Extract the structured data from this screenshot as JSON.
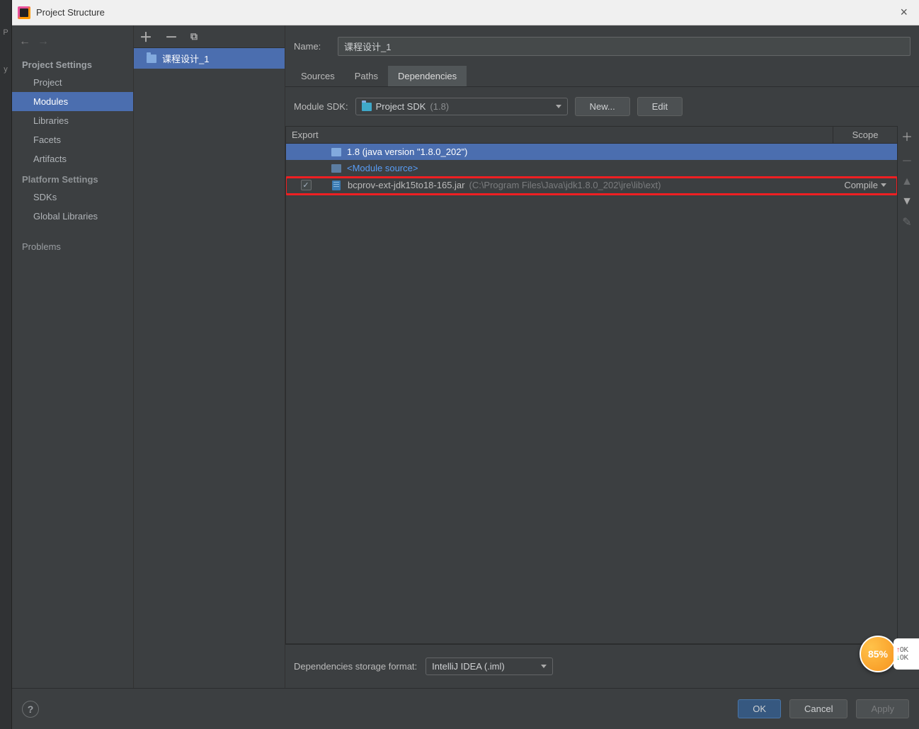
{
  "window": {
    "title": "Project Structure"
  },
  "sidebar": {
    "sections": {
      "project": "Project Settings",
      "platform": "Platform Settings"
    },
    "items": {
      "project": "Project",
      "modules": "Modules",
      "libraries": "Libraries",
      "facets": "Facets",
      "artifacts": "Artifacts",
      "sdks": "SDKs",
      "global_libraries": "Global Libraries",
      "problems": "Problems"
    }
  },
  "modules": {
    "selected": "课程设计_1"
  },
  "details": {
    "name_label": "Name:",
    "name_value": "课程设计_1",
    "tabs": {
      "sources": "Sources",
      "paths": "Paths",
      "dependencies": "Dependencies"
    },
    "sdk_label": "Module SDK:",
    "sdk_value": "Project SDK",
    "sdk_version": "(1.8)",
    "new_btn": "New...",
    "edit_btn": "Edit",
    "columns": {
      "export": "Export",
      "scope": "Scope"
    },
    "rows": {
      "sdk": "1.8 (java version \"1.8.0_202\")",
      "module_source": "<Module source>",
      "jar_name": "bcprov-ext-jdk15to18-165.jar",
      "jar_path": "(C:\\Program Files\\Java\\jdk1.8.0_202\\jre\\lib\\ext)",
      "jar_scope": "Compile"
    },
    "storage_label": "Dependencies storage format:",
    "storage_value": "IntelliJ IDEA (.iml)"
  },
  "buttons": {
    "ok": "OK",
    "cancel": "Cancel",
    "apply": "Apply"
  },
  "widget": {
    "percent": "85%",
    "up": "0K",
    "down": "0K"
  }
}
